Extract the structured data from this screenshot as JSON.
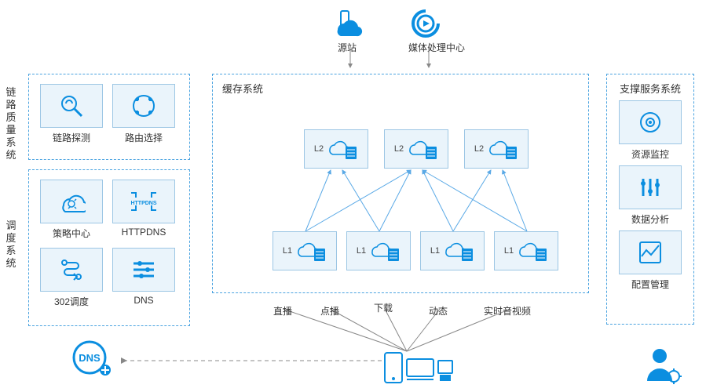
{
  "top": {
    "origin": "源站",
    "media": "媒体处理中心"
  },
  "left": {
    "link_quality_title": "链路质量系统",
    "schedule_title": "调度系统",
    "link_probe": "链路探测",
    "routing": "路由选择",
    "policy": "策略中心",
    "httpdns": "HTTPDNS",
    "redirect302": "302调度",
    "dns": "DNS"
  },
  "center": {
    "cache_title": "缓存系统",
    "l2_a": "L2",
    "l2_b": "L2",
    "l2_c": "L2",
    "l1_a": "L1",
    "l1_b": "L1",
    "l1_c": "L1",
    "l1_d": "L1",
    "svc_live": "直播",
    "svc_vod": "点播",
    "svc_dl": "下载",
    "svc_dyn": "动态",
    "svc_rtc": "实时音视频"
  },
  "right": {
    "support_title": "支撑服务系统",
    "monitor": "资源监控",
    "analytics": "数据分析",
    "config": "配置管理"
  },
  "dns_badge": "DNS"
}
